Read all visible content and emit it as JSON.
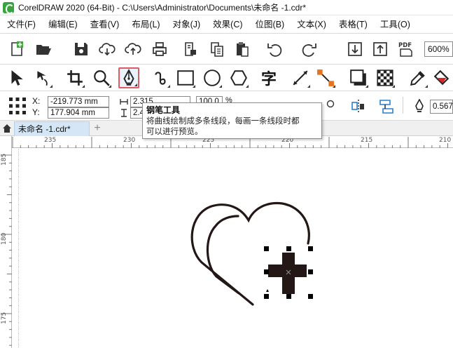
{
  "window": {
    "title": "CorelDRAW 2020 (64-Bit) - C:\\Users\\Administrator\\Documents\\未命名 -1.cdr*"
  },
  "menu": [
    "文件(F)",
    "编辑(E)",
    "查看(V)",
    "布局(L)",
    "对象(J)",
    "效果(C)",
    "位图(B)",
    "文本(X)",
    "表格(T)",
    "工具(O)"
  ],
  "toolbar": {
    "zoom": "600%",
    "pdf_label": "PDF",
    "icons": [
      "new-document-icon",
      "open-folder-icon",
      "save-icon",
      "cloud-download-icon",
      "cloud-upload-icon",
      "print-icon",
      "doc-properties-icon",
      "doc-copy-icon",
      "paste-icon",
      "undo-icon",
      "redo-icon",
      "import-icon",
      "export-icon",
      "publish-pdf-icon"
    ]
  },
  "toolbox": {
    "active_tool": "pen-tool",
    "text_tool_glyph": "字",
    "tools": [
      "pick-tool",
      "shape-tool",
      "crop-tool",
      "zoom-tool",
      "pen-tool",
      "spiral-tool",
      "rectangle-tool",
      "ellipse-tool",
      "polygon-tool",
      "text-tool",
      "line-tool",
      "connector-tool",
      "drop-shadow-tool",
      "transparency-tool",
      "eyedropper-tool",
      "fill-tool"
    ]
  },
  "property_bar": {
    "x_label": "X:",
    "y_label": "Y:",
    "x_value": "-219.773 mm",
    "y_value": "177.904 mm",
    "width_value": "2.315",
    "height_value": "2.4",
    "scale_value": "100.0",
    "scale_unit": "%",
    "outline_width": "0.567"
  },
  "tabs": {
    "document": "未命名 -1.cdr*",
    "add": "+"
  },
  "ruler": {
    "h_labels": [
      "235",
      "230",
      "225",
      "220",
      "215",
      "210"
    ],
    "v_labels": [
      "185",
      "180",
      "175"
    ]
  },
  "tooltip": {
    "title": "钢笔工具",
    "line1": "将曲线绘制成多条线段，每画一条线段时都",
    "line2": "可以进行预览。"
  },
  "colors": {
    "accent": "#e05a63",
    "tab_active": "#d5e7f7",
    "shape_fill": "#231815",
    "selected_tool_bg": "#eaf3fb"
  }
}
